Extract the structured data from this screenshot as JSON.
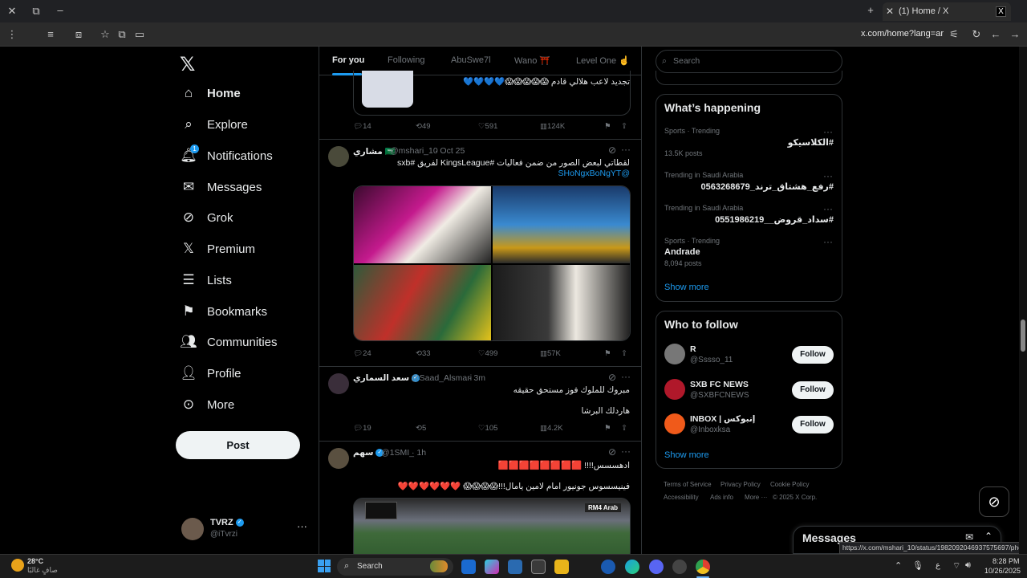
{
  "browser": {
    "tab_title": "(1) Home / X",
    "url": "x.com/home?lang=ar",
    "status_url": "https://x.com/mshari_10/status/1982092046937575697/photo/4"
  },
  "nav": {
    "items": [
      {
        "label": "Home",
        "icon": "home-icon"
      },
      {
        "label": "Explore",
        "icon": "search-icon"
      },
      {
        "label": "Notifications",
        "icon": "bell-icon",
        "badge": "1"
      },
      {
        "label": "Messages",
        "icon": "mail-icon"
      },
      {
        "label": "Grok",
        "icon": "grok-icon"
      },
      {
        "label": "Premium",
        "icon": "x-logo-icon"
      },
      {
        "label": "Lists",
        "icon": "list-icon"
      },
      {
        "label": "Bookmarks",
        "icon": "bookmark-icon"
      },
      {
        "label": "Communities",
        "icon": "people-icon"
      },
      {
        "label": "Profile",
        "icon": "person-icon"
      },
      {
        "label": "More",
        "icon": "more-circle-icon"
      }
    ],
    "post_button": "Post",
    "account": {
      "name": "TVRZ",
      "handle": "@iTvrzi"
    }
  },
  "feed": {
    "tabs": [
      "For you",
      "Following",
      "AbuSwe7l",
      "Wano ⛩️",
      "Level One ☝️"
    ],
    "tweets": [
      {
        "text_line1": "تجديد لاعب هلالي قادم 😱😱😱😱😱💙💙💙💙",
        "replies": "14",
        "reposts": "49",
        "likes": "591",
        "views": "124K"
      },
      {
        "name": "مشاري 🇸🇦",
        "handle": "@mshari_10",
        "time": "· Oct 25",
        "text_line1": "لقطاتي لبعض الصور من ضمن فعاليات #KingsLeague لفريق #sxb",
        "text_line2": "@SHoNgxBoNgYT",
        "replies": "24",
        "reposts": "33",
        "likes": "499",
        "views": "57K"
      },
      {
        "name": "سعد السماري",
        "handle": "@Saad_Alsmari",
        "time": "· 3m",
        "text_line1": "مبروك للملوك فوز مستحق حقيقه",
        "text_line2": "هاردلك البرشا",
        "replies": "19",
        "reposts": "5",
        "likes": "105",
        "views": "4.2K"
      },
      {
        "name": "سهم",
        "handle": "@1SMI_",
        "time": "· 1h",
        "text_line1": "ادهسسس!!!! 🟥🟥🟥🟥🟥🟥🟥🟥",
        "text_line2": "فينيسسوس جونيور امام لامين يامال!!!😱😱😱😱 ❤️❤️❤️❤️❤️❤️",
        "media_badge": "RM4 Arab"
      }
    ]
  },
  "sidebar": {
    "search_placeholder": "Search",
    "happening": {
      "title": "What’s happening",
      "trends": [
        {
          "category": "Sports · Trending",
          "name": "#الكلاسيكو",
          "count": "13.5K posts"
        },
        {
          "category": "Trending in Saudi Arabia",
          "name": "#رفع_هشتاق_ترند_0563268679",
          "count": ""
        },
        {
          "category": "Trending in Saudi Arabia",
          "name": "#سداد_قروض__0551986219",
          "count": ""
        },
        {
          "category": "Sports · Trending",
          "name": "Andrade",
          "count": "8,094 posts"
        }
      ],
      "show_more": "Show more"
    },
    "who_to_follow": {
      "title": "Who to follow",
      "accounts": [
        {
          "name": "R",
          "handle": "@Sssso_11",
          "button": "Follow"
        },
        {
          "name": "SXB FC NEWS",
          "handle": "@SXBFCNEWS",
          "button": "Follow"
        },
        {
          "name": "INBOX | إنبوكس",
          "handle": "@Inboxksa",
          "button": "Follow"
        }
      ],
      "show_more": "Show more"
    },
    "footer": [
      "Terms of Service",
      "Privacy Policy",
      "Cookie Policy",
      "Accessibility",
      "Ads info",
      "More ···",
      "© 2025 X Corp."
    ],
    "messages_dock": "Messages"
  },
  "taskbar": {
    "weather_temp": "28°C",
    "weather_desc": "صافٍ غالبًا",
    "search_label": "Search",
    "time": "8:28 PM",
    "date": "10/26/2025",
    "lang": "ع"
  }
}
